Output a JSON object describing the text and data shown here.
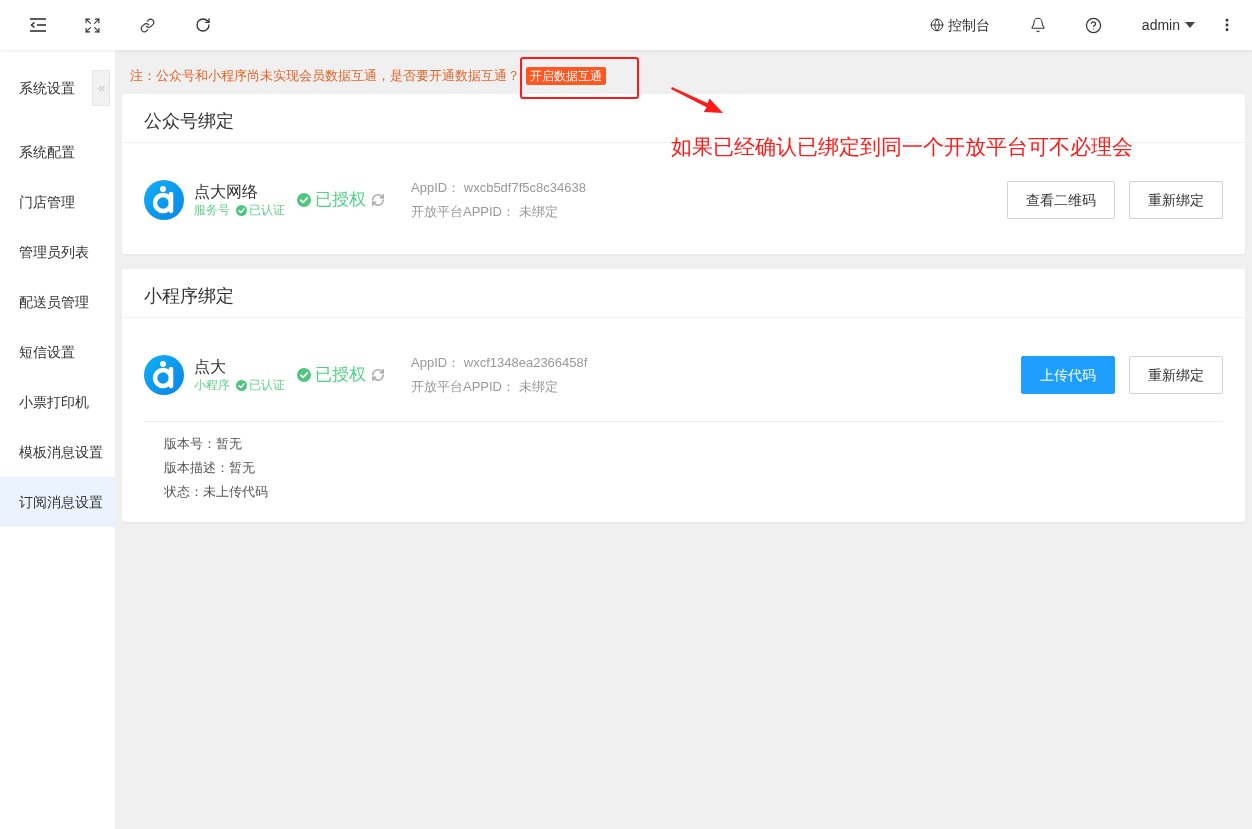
{
  "header": {
    "console": "控制台",
    "user": "admin"
  },
  "sidebar": {
    "title": "系统设置",
    "items": [
      {
        "label": "系统配置",
        "selected": false
      },
      {
        "label": "门店管理",
        "selected": false
      },
      {
        "label": "管理员列表",
        "selected": false
      },
      {
        "label": "配送员管理",
        "selected": false
      },
      {
        "label": "短信设置",
        "selected": false
      },
      {
        "label": "小票打印机",
        "selected": false
      },
      {
        "label": "模板消息设置",
        "selected": false
      },
      {
        "label": "订阅消息设置",
        "selected": true
      }
    ]
  },
  "notice": {
    "text": "注：公众号和小程序尚未实现会员数据互通，是否要开通数据互通？",
    "action": "开启数据互通"
  },
  "annotation": {
    "text": "如果已经确认已绑定到同一个开放平台可不必理会"
  },
  "cards": [
    {
      "title": "公众号绑定",
      "account": {
        "name": "点大网络",
        "type": "服务号",
        "verified": "已认证",
        "status": "已授权"
      },
      "fields": [
        {
          "label": "AppID：",
          "value": "wxcb5df7f5c8c34638"
        },
        {
          "label": "开放平台APPID：",
          "value": "未绑定"
        }
      ],
      "buttons": [
        {
          "label": "查看二维码",
          "kind": "default"
        },
        {
          "label": "重新绑定",
          "kind": "default"
        }
      ]
    },
    {
      "title": "小程序绑定",
      "account": {
        "name": "点大",
        "type": "小程序",
        "verified": "已认证",
        "status": "已授权"
      },
      "fields": [
        {
          "label": "AppID：",
          "value": "wxcf1348ea2366458f"
        },
        {
          "label": "开放平台APPID：",
          "value": "未绑定"
        }
      ],
      "buttons": [
        {
          "label": "上传代码",
          "kind": "primary"
        },
        {
          "label": "重新绑定",
          "kind": "default"
        }
      ],
      "details": [
        "版本号：暂无",
        "版本描述：暂无",
        "状态：未上传代码"
      ]
    }
  ]
}
